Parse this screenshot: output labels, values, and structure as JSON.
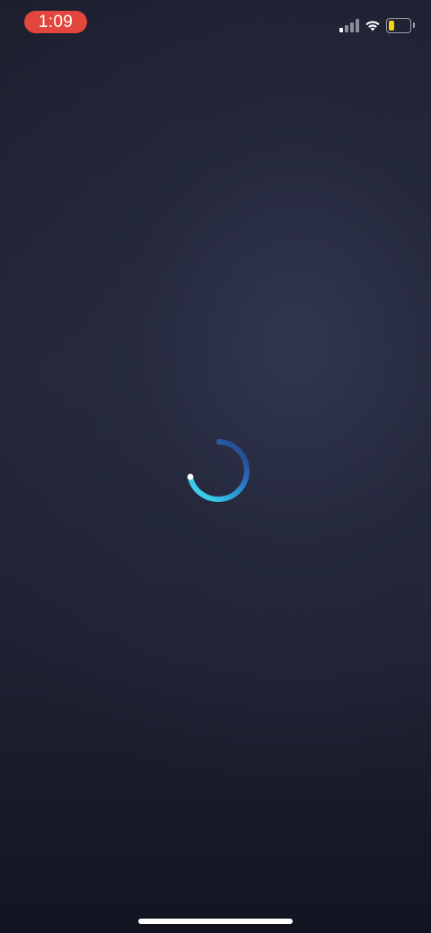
{
  "status_bar": {
    "time": "1:09",
    "time_pill_color": "#e2463c",
    "signal_icon": "cellular-signal-icon",
    "signal_bars_active": 1,
    "signal_bars_total": 4,
    "wifi_icon": "wifi-icon",
    "battery_icon": "battery-icon",
    "battery_level": 0.25,
    "battery_color": "#f5d314"
  },
  "loading": {
    "icon": "loading-spinner-icon",
    "accent_start": "#2a5fb8",
    "accent_end": "#3fd6ea"
  },
  "home_indicator": {
    "icon": "home-indicator"
  }
}
